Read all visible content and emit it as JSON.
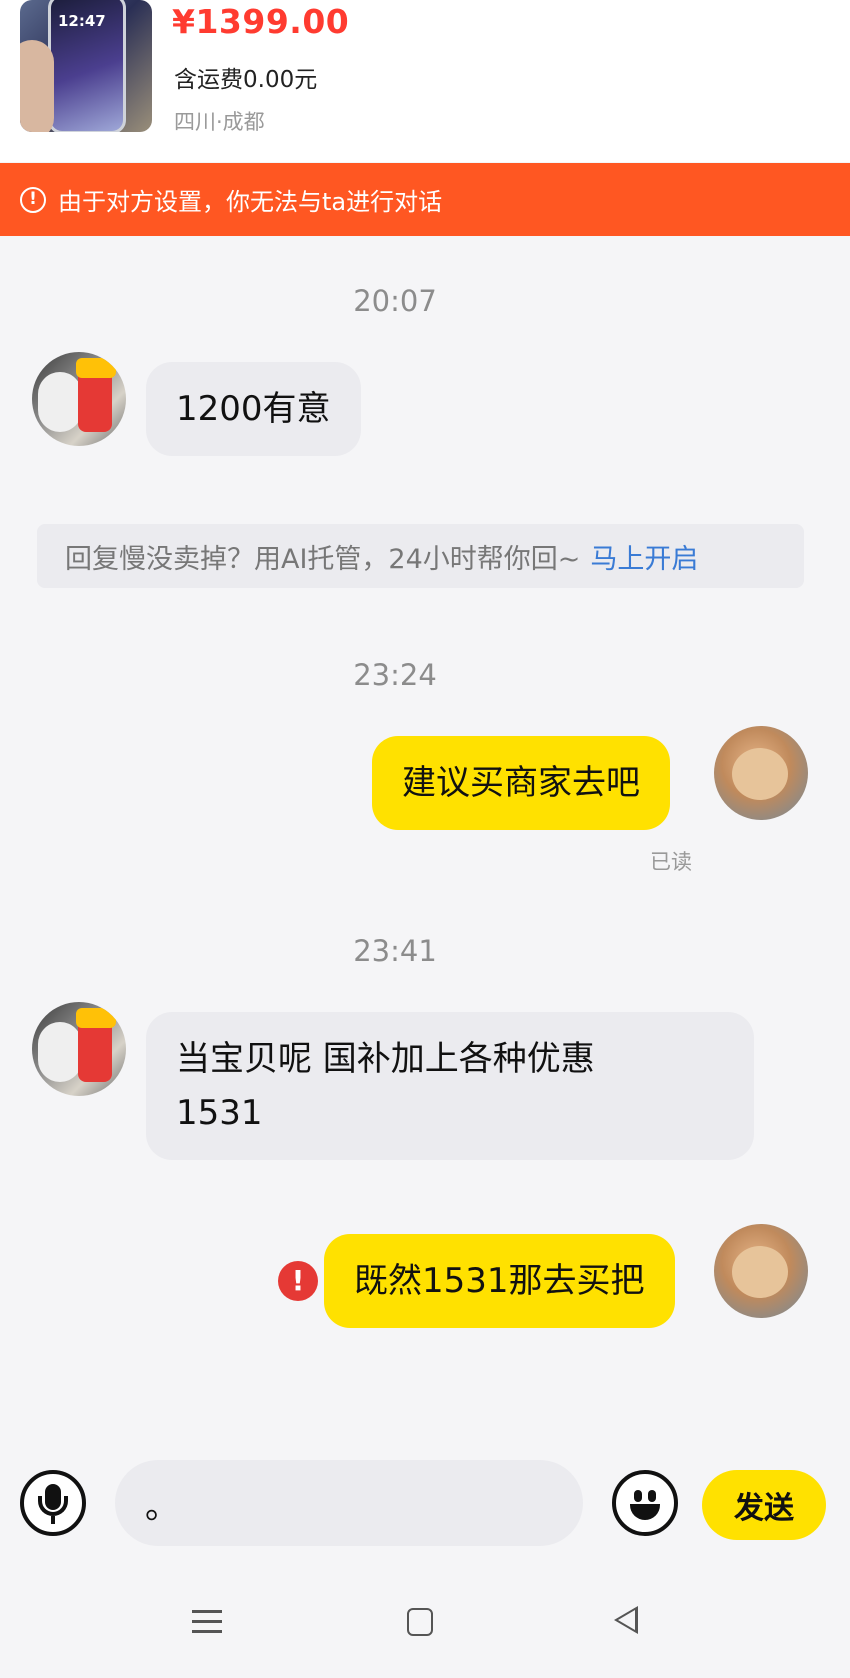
{
  "product": {
    "price": "¥1399.00",
    "shipping": "含运费0.00元",
    "location": "四川·成都",
    "thumb_time": "12:47"
  },
  "warning": {
    "text": "由于对方设置，你无法与ta进行对话",
    "icon": "!"
  },
  "messages": [
    {
      "time": "20:07",
      "from": "other",
      "text": "1200有意"
    },
    {
      "time": "23:24",
      "from": "me",
      "text": "建议买商家去吧",
      "status": "已读"
    },
    {
      "time": "23:41",
      "from": "other",
      "text_line1": "当宝贝呢   国补加上各种优惠",
      "text_line2": "1531"
    },
    {
      "from": "me",
      "text": "既然1531那去买把",
      "failed_icon": "!"
    }
  ],
  "ai_tip": {
    "text": "回复慢没卖掉？用AI托管，24小时帮你回~",
    "link": "马上开启"
  },
  "input": {
    "value": "。",
    "send_label": "发送"
  },
  "colors": {
    "warning_bar": "#ff5722",
    "price": "#ff3b30",
    "my_bubble": "#ffe100",
    "their_bubble": "#ebebef",
    "link": "#3a7bd5"
  },
  "icons": {
    "voice": "microphone-icon",
    "emoji": "smiley-icon",
    "nav": [
      "menu-icon",
      "home-icon",
      "back-icon"
    ]
  }
}
